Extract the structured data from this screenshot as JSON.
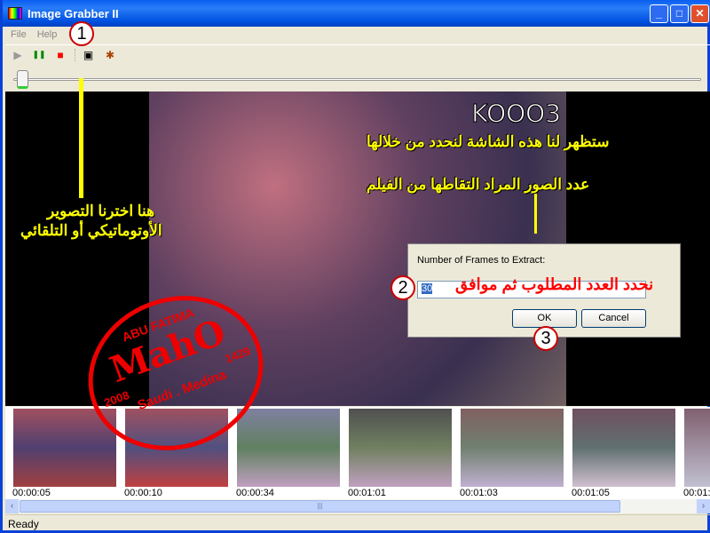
{
  "window": {
    "title": "Image Grabber II",
    "minimize": "_",
    "maximize": "□",
    "close": "✕"
  },
  "menu": [
    "File",
    "Help"
  ],
  "toolbar": {
    "icons": [
      "play-icon",
      "pause-icon",
      "stop-icon",
      "screen-capture-icon",
      "auto-capture-icon"
    ],
    "play": "▶",
    "pause": "❚❚",
    "stop": "■",
    "screen": "▣",
    "auto": "✱"
  },
  "slider": {
    "position_percent": 2
  },
  "video": {
    "logo": "KOOO3"
  },
  "annotations": {
    "top1": "ستظهر لنا هذه الشاشة لنحدد من خلالها",
    "top2": "عدد الصور المراد التقاطها من الفيلم",
    "left1": "هنا اخترنا التصوير",
    "left2": "الأوتوماتيكي أو التلقائي",
    "red": "نحدد العدد المطلوب ثم موافق",
    "n1": "1",
    "n2": "2",
    "n3": "3"
  },
  "dialog": {
    "label": "Number of Frames to Extract:",
    "value": "30",
    "ok": "OK",
    "cancel": "Cancel"
  },
  "stamp": {
    "top": "ABU FATIMA",
    "center": "MahO",
    "left": "2008",
    "right": "1429",
    "bottom": "Saudi . Medina"
  },
  "thumbnails": [
    {
      "time": "00:00:05"
    },
    {
      "time": "00:00:10"
    },
    {
      "time": "00:00:34"
    },
    {
      "time": "00:01:01"
    },
    {
      "time": "00:01:03"
    },
    {
      "time": "00:01:05"
    },
    {
      "time": "00:01:"
    }
  ],
  "status": {
    "text": "Ready"
  },
  "colors": {
    "titlebar": "#0a5ef0",
    "annotation": "#ffff00",
    "stamp": "#e00000"
  }
}
